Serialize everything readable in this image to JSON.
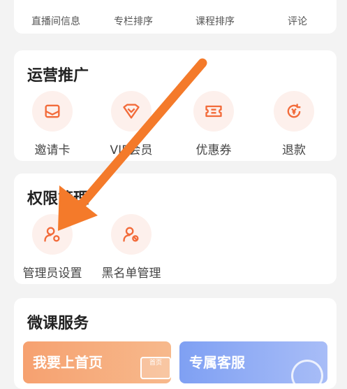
{
  "top_row": {
    "items": [
      {
        "label": "直播间信息"
      },
      {
        "label": "专栏排序"
      },
      {
        "label": "课程排序"
      },
      {
        "label": "评论"
      }
    ]
  },
  "operations": {
    "title": "运营推广",
    "items": [
      {
        "label": "邀请卡",
        "icon": "envelope-icon"
      },
      {
        "label": "VIP会员",
        "icon": "vip-crown-icon"
      },
      {
        "label": "优惠券",
        "icon": "coupon-icon"
      },
      {
        "label": "退款",
        "icon": "refund-icon"
      }
    ]
  },
  "permissions": {
    "title": "权限管理",
    "items": [
      {
        "label": "管理员设置",
        "icon": "admin-settings-icon"
      },
      {
        "label": "黑名单管理",
        "icon": "blacklist-icon"
      }
    ]
  },
  "micro_course": {
    "title": "微课服务",
    "banners": [
      {
        "label": "我要上首页",
        "badge": "首页"
      },
      {
        "label": "专属客服"
      }
    ]
  },
  "colors": {
    "accent": "#f26b3a",
    "icon_bg": "#fdf0ec",
    "arrow": "#f47a2a",
    "banner_orange": "#f6a170",
    "banner_blue": "#7fa0f3"
  }
}
